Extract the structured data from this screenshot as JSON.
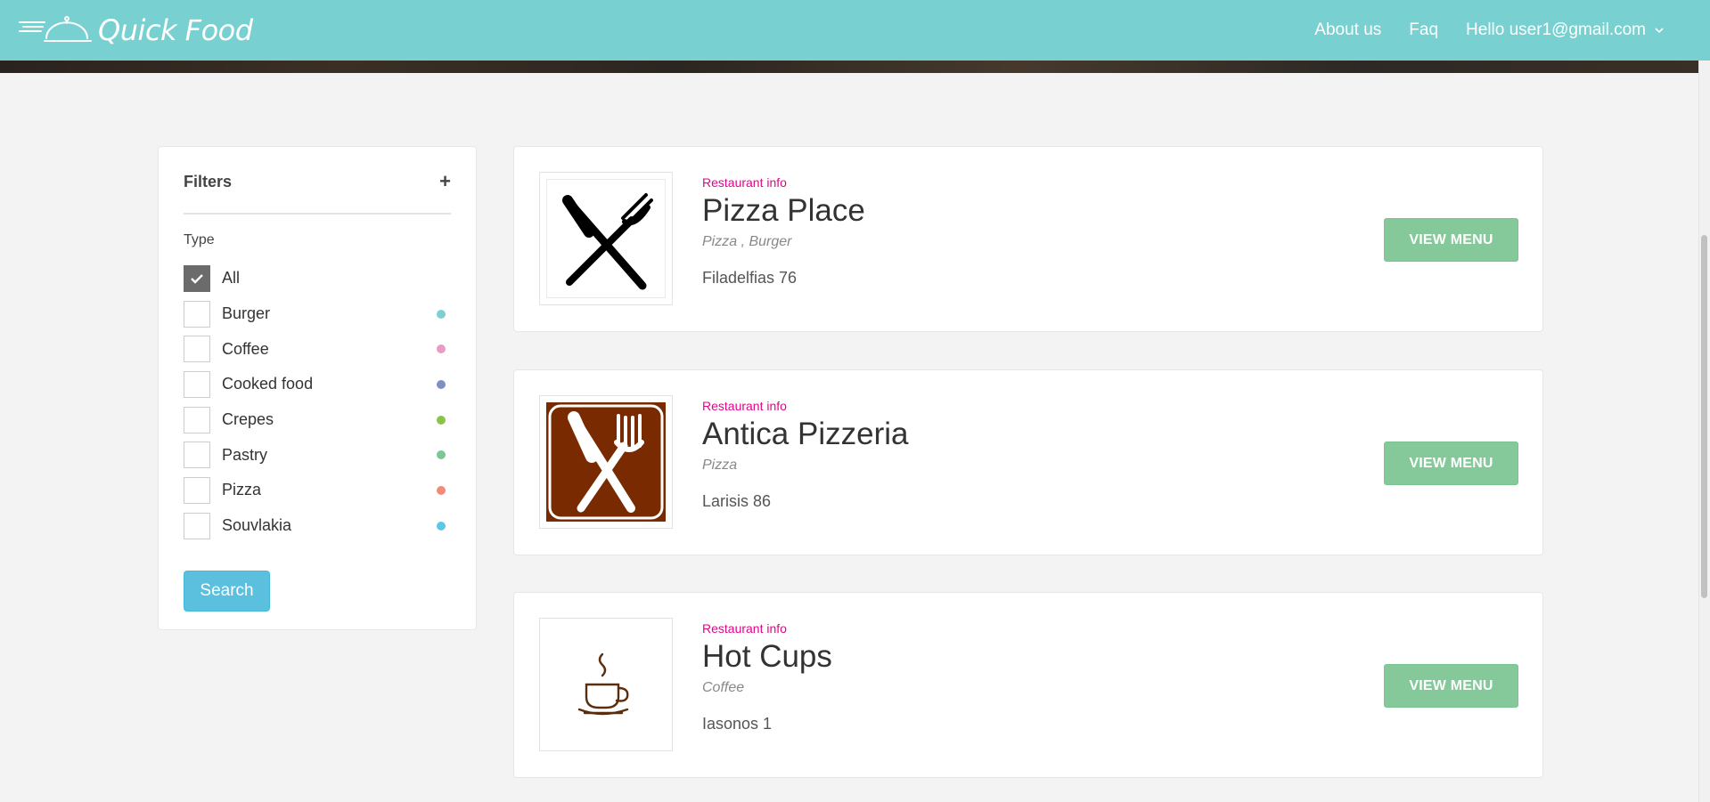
{
  "header": {
    "brand": "Quick Food",
    "nav": [
      {
        "label": "About us"
      },
      {
        "label": "Faq"
      }
    ],
    "user_greeting": "Hello user1@gmail.com"
  },
  "filters": {
    "title": "Filters",
    "toggle_symbol": "+",
    "type_label": "Type",
    "items": [
      {
        "label": "All",
        "checked": true,
        "color": ""
      },
      {
        "label": "Burger",
        "checked": false,
        "color": "#7fcfcf"
      },
      {
        "label": "Coffee",
        "checked": false,
        "color": "#e89cc4"
      },
      {
        "label": "Cooked food",
        "checked": false,
        "color": "#7f8fc4"
      },
      {
        "label": "Crepes",
        "checked": false,
        "color": "#8bc34a"
      },
      {
        "label": "Pastry",
        "checked": false,
        "color": "#7cc796"
      },
      {
        "label": "Pizza",
        "checked": false,
        "color": "#f28b77"
      },
      {
        "label": "Souvlakia",
        "checked": false,
        "color": "#5bc8e8"
      }
    ],
    "search_label": "Search"
  },
  "restaurants": [
    {
      "info_label": "Restaurant info",
      "name": "Pizza Place",
      "types": "Pizza , Burger",
      "address": "Filadelfias 76",
      "button": "VIEW MENU",
      "logo": "fork-knife-icon"
    },
    {
      "info_label": "Restaurant info",
      "name": "Antica Pizzeria",
      "types": "Pizza",
      "address": "Larisis 86",
      "button": "VIEW MENU",
      "logo": "restaurant-sign-icon"
    },
    {
      "info_label": "Restaurant info",
      "name": "Hot Cups",
      "types": "Coffee",
      "address": "Iasonos 1",
      "button": "VIEW MENU",
      "logo": "coffee-cup-icon"
    }
  ],
  "colors": {
    "navbar": "#78d0d0",
    "accent_pink": "#e0068a",
    "view_button": "#85c99a",
    "search_button": "#5bc0de"
  }
}
